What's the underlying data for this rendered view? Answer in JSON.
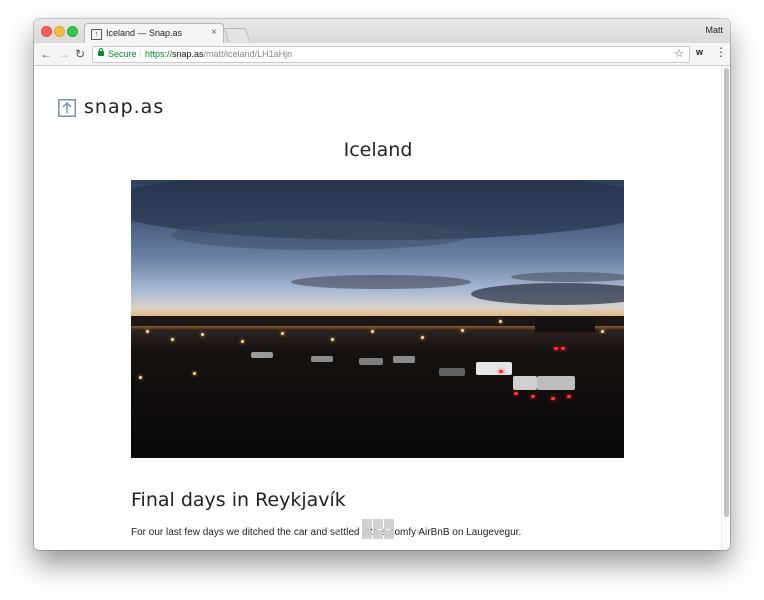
{
  "browser": {
    "tab_title": "Iceland — Snap.as",
    "tab_close": "×",
    "favicon_glyph": "↑",
    "profile_name": "Matt",
    "secure_label": "Secure",
    "url_scheme": "https://",
    "url_host": "snap.as",
    "url_path": "/matt/iceland/LH1aHjn",
    "nav_back": "←",
    "nav_forward": "→",
    "nav_reload": "↻",
    "star": "☆",
    "extension_label": "w",
    "menu": "⋮",
    "icons": {
      "back": "arrow-left-icon",
      "forward": "arrow-right-icon",
      "reload": "reload-icon",
      "lock": "lock-icon",
      "star": "star-icon",
      "menu": "kebab-menu-icon"
    }
  },
  "site": {
    "logo_text": "snap.as",
    "logo_icon": "upload-arrow-icon",
    "album_title": "Iceland"
  },
  "post": {
    "title": "Final days in Reykjavík",
    "body": "For our last few days we ditched the car and settled into a comfy AirBnB on Laugevegur."
  },
  "pager": {
    "prev": "←",
    "next": "→",
    "grid_icon": "grid-icon"
  },
  "colors": {
    "secure_green": "#0a8a2c",
    "text": "#222222",
    "pager_gray": "#c8c8c8"
  }
}
